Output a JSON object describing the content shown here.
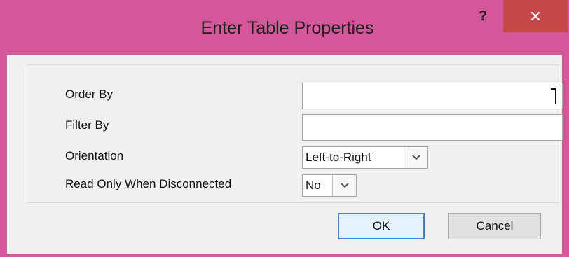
{
  "dialog": {
    "title": "Enter Table Properties",
    "help_label": "?",
    "close_icon": "close-icon"
  },
  "fields": {
    "order_by": {
      "label": "Order By",
      "value": ""
    },
    "filter_by": {
      "label": "Filter By",
      "value": ""
    },
    "orientation": {
      "label": "Orientation",
      "value": "Left-to-Right"
    },
    "read_only": {
      "label": "Read Only When Disconnected",
      "value": "No"
    }
  },
  "buttons": {
    "ok": "OK",
    "cancel": "Cancel"
  },
  "colors": {
    "titlebar": "#d4579a",
    "close_button": "#c7484a",
    "client": "#f0f0f0",
    "default_button_border": "#3c7fd4"
  }
}
